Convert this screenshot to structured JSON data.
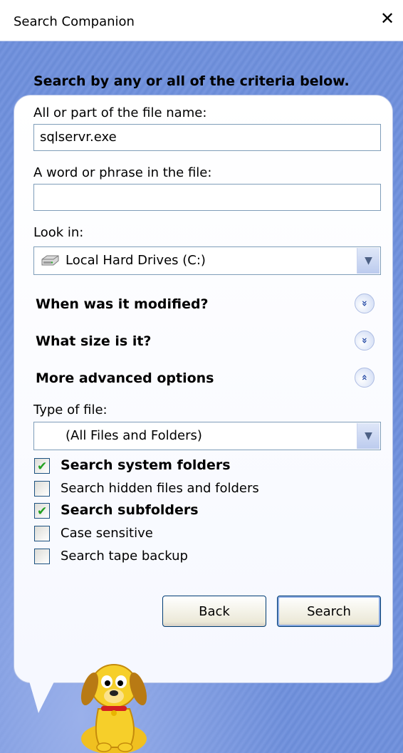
{
  "window": {
    "title": "Search Companion",
    "close_label": "✕"
  },
  "form": {
    "heading": "Search by any or all of the criteria below.",
    "filename_label": "All or part of the file name:",
    "filename_value": "sqlservr.exe",
    "phrase_label": "A word or phrase in the file:",
    "phrase_value": "",
    "lookin_label": "Look in:",
    "lookin_value": "Local Hard Drives (C:)",
    "modified_label": "When was it modified?",
    "size_label": "What size is it?",
    "advanced_label": "More advanced options",
    "type_label": "Type of file:",
    "type_value": "(All Files and Folders)"
  },
  "options": [
    {
      "label": "Search system folders",
      "checked": true
    },
    {
      "label": "Search hidden files and folders",
      "checked": false
    },
    {
      "label": "Search subfolders",
      "checked": true
    },
    {
      "label": "Case sensitive",
      "checked": false
    },
    {
      "label": "Search tape backup",
      "checked": false
    }
  ],
  "buttons": {
    "back": "Back",
    "search": "Search"
  },
  "icons": {
    "expand": "«",
    "collapse": "»",
    "dropdown": "▼",
    "check": "✔"
  }
}
